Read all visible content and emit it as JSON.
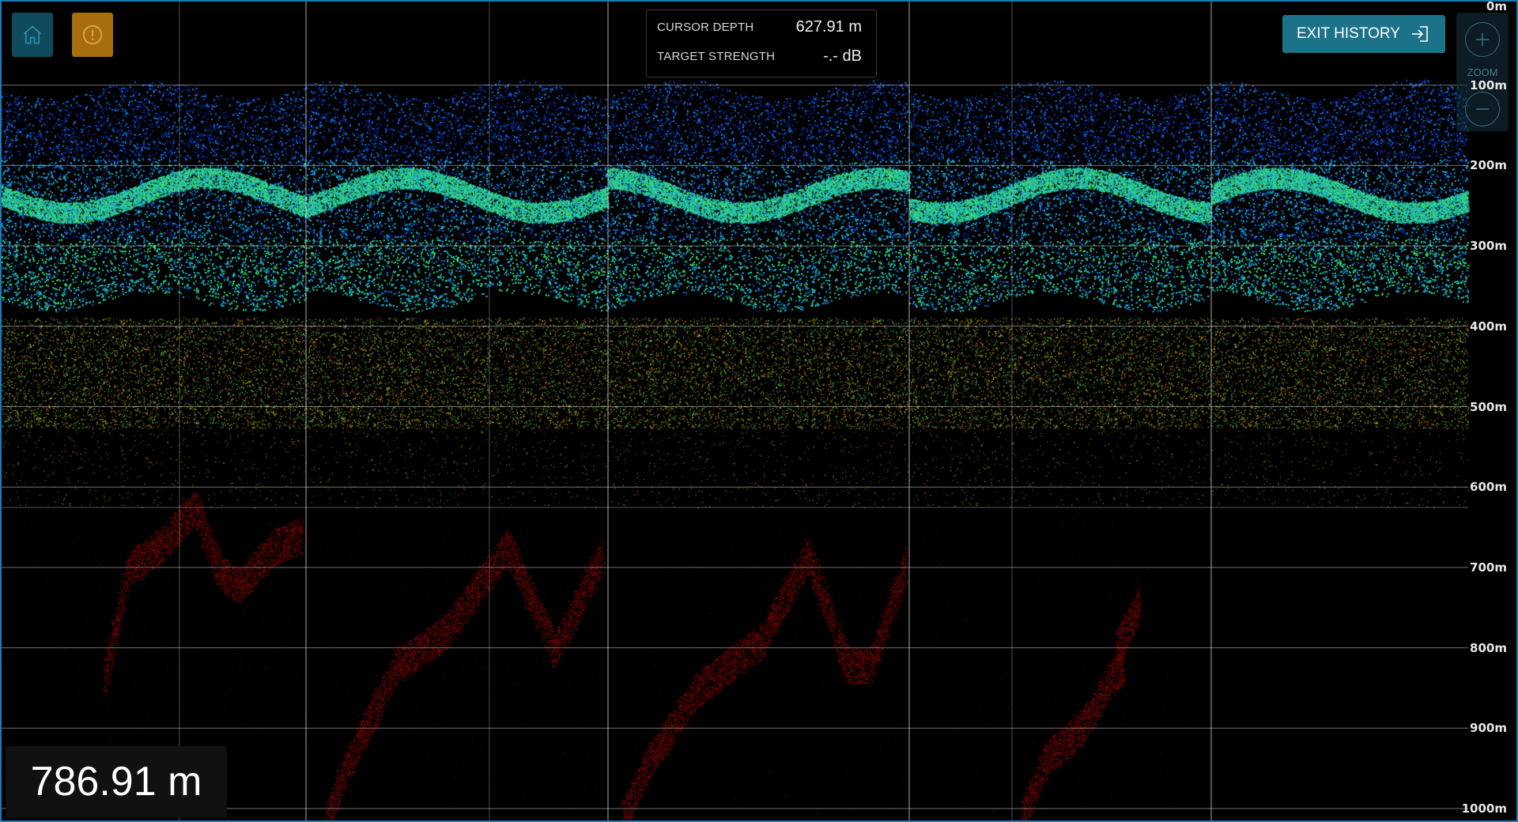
{
  "toolbar": {
    "home_icon": "home-icon",
    "alert_icon": "alert-icon",
    "home_color": "#0f4b5d",
    "alert_color": "#a86d0c"
  },
  "cursor_info": {
    "depth_label": "CURSOR DEPTH",
    "depth_value": "627.91 m",
    "strength_label": "TARGET STRENGTH",
    "strength_value": "-.- dB"
  },
  "exit_history": {
    "label": "EXIT HISTORY",
    "icon": "exit-icon",
    "color": "#1c7288"
  },
  "zoom": {
    "label": "ZOOM",
    "in_icon": "plus-icon",
    "out_icon": "minus-icon"
  },
  "depth_axis": {
    "ticks": [
      "0m",
      "100m",
      "200m",
      "300m",
      "400m",
      "500m",
      "600m",
      "700m",
      "800m",
      "900m",
      "1000m"
    ],
    "min_m": 0,
    "max_m": 1000
  },
  "current_depth": "786.91 m",
  "echogram": {
    "sections": 5,
    "palette": [
      "#1032a8",
      "#1a7ad8",
      "#22b8c8",
      "#3fe070",
      "#e8d020",
      "#e07018",
      "#b01010",
      "#7a0000"
    ],
    "grid_color": "#d0d0d0"
  }
}
